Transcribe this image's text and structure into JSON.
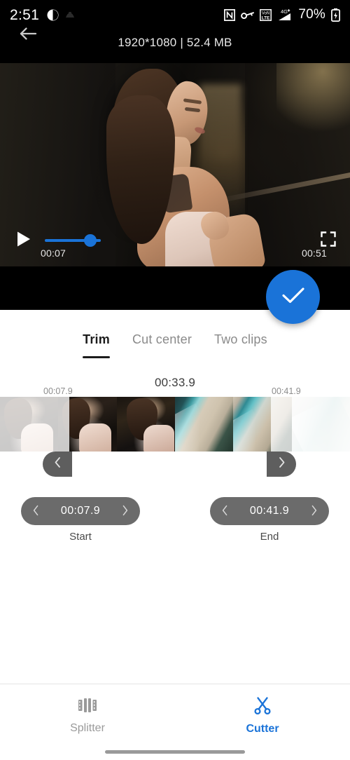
{
  "status_bar": {
    "time": "2:51",
    "battery_percent": "70%",
    "icons": [
      "app-badge-icon",
      "notification-icon",
      "nfc-icon",
      "vpn-key-icon",
      "volte-icon",
      "signal-4g-plus-icon",
      "battery-charging-icon"
    ]
  },
  "header": {
    "title": "1920*1080 | 52.4 MB",
    "back_icon": "back-arrow-icon"
  },
  "player": {
    "current_time": "00:07",
    "total_time": "00:51",
    "play_icon": "play-icon",
    "fullscreen_icon": "fullscreen-icon",
    "progress_percent": 70
  },
  "confirm": {
    "icon": "check-icon",
    "color": "#1a73d8"
  },
  "tabs": [
    {
      "label": "Trim",
      "active": true
    },
    {
      "label": "Cut center",
      "active": false
    },
    {
      "label": "Two clips",
      "active": false
    }
  ],
  "timeline": {
    "duration": "00:33.9",
    "start_marker": "00:07.9",
    "end_marker": "00:41.9",
    "handle_left_icon": "chevron-left-icon",
    "handle_right_icon": "chevron-right-icon",
    "thumbnails": [
      {
        "id": "thumb-1",
        "selected": false
      },
      {
        "id": "thumb-2",
        "selected": true
      },
      {
        "id": "thumb-3",
        "selected": true
      },
      {
        "id": "thumb-4",
        "selected": true
      },
      {
        "id": "thumb-5",
        "selected": true
      },
      {
        "id": "thumb-6",
        "selected": false
      }
    ]
  },
  "steppers": {
    "start": {
      "value": "00:07.9",
      "label": "Start",
      "dec_icon": "chevron-left-icon",
      "inc_icon": "chevron-right-icon"
    },
    "end": {
      "value": "00:41.9",
      "label": "End",
      "dec_icon": "chevron-left-icon",
      "inc_icon": "chevron-right-icon"
    }
  },
  "bottom_nav": [
    {
      "label": "Splitter",
      "icon": "film-splitter-icon",
      "active": false
    },
    {
      "label": "Cutter",
      "icon": "scissors-icon",
      "active": true
    }
  ],
  "theme": {
    "accent": "#1a73d8",
    "inactive": "#9a9a9a",
    "chrome": "#000000"
  }
}
